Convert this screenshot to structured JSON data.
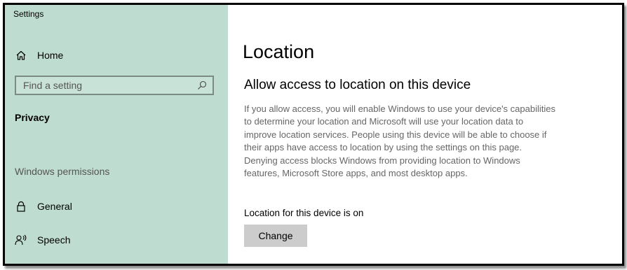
{
  "window": {
    "title": "Settings"
  },
  "sidebar": {
    "home_label": "Home",
    "home_icon": "home-icon",
    "search_placeholder": "Find a setting",
    "search_icon": "search-icon",
    "privacy_label": "Privacy",
    "windows_permissions_label": "Windows permissions",
    "items": [
      {
        "label": "General",
        "icon": "lock-icon"
      },
      {
        "label": "Speech",
        "icon": "speech-icon"
      }
    ]
  },
  "main": {
    "title": "Location",
    "section_heading": "Allow access to location on this device",
    "description": "If you allow access, you will enable Windows to use your device's capabilities to determine your location and Microsoft will use your location data to improve location services. People using this device will be able to choose if their apps have access to location by using the settings on this page. Denying access blocks Windows from providing location to Windows features, Microsoft Store apps, and most desktop apps.",
    "status_text": "Location for this device is on",
    "change_button_label": "Change"
  },
  "colors": {
    "sidebar_bg": "#bfdcd1",
    "content_bg": "#ffffff",
    "button_bg": "#cccccc",
    "description_text": "#666666"
  }
}
